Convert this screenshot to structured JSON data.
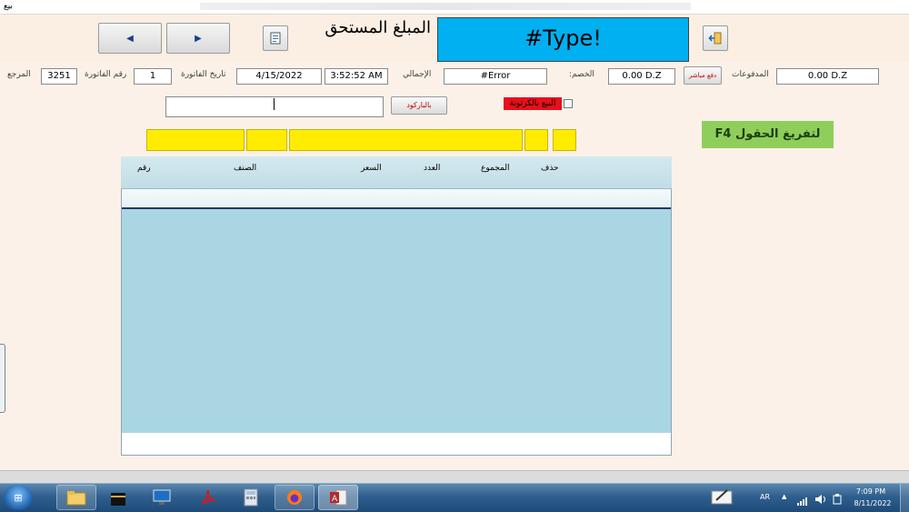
{
  "window": {
    "title": "بيع"
  },
  "header": {
    "amount_due_label": "المبلغ المستحق",
    "amount_due_value": "#Type!"
  },
  "info_row": {
    "reference_label": "المرجع",
    "reference_value": "3251",
    "invoice_number_label": "رقم الفاتورة",
    "invoice_number_value": "1",
    "invoice_date_label": "تاريخ الفاتورة",
    "invoice_date_value": "4/15/2022",
    "time_value": "3:52:52 AM",
    "total_label": "الإجمالي",
    "total_value": "#Error",
    "discount_label": "الخصم:",
    "discount_value": "0.00 D.Z",
    "direct_payment_button": "دفع مباشر",
    "payments_label": "المدفوعات",
    "payments_value": "0.00 D.Z"
  },
  "barcode": {
    "input_value": "",
    "button_label": "بالباركود",
    "carton_sale_label": "البيع بالكرتونة",
    "carton_sale_checked": false
  },
  "clear_fields_button": "لتفريغ الحقول F4",
  "grid": {
    "columns": {
      "number": "رقم",
      "item": "الصنف",
      "price": "السعر",
      "quantity": "العدد",
      "total": "المجموع",
      "delete": "حذف"
    }
  },
  "taskbar": {
    "language": "AR",
    "time": "7:09 PM",
    "date": "8/11/2022"
  },
  "colors": {
    "amount_box": "#00b0f0",
    "yellow_fields": "#ffec00",
    "clear_button": "#8fce5a",
    "grid_body": "#aad5e2",
    "carton_label_bg": "#e8101a"
  }
}
